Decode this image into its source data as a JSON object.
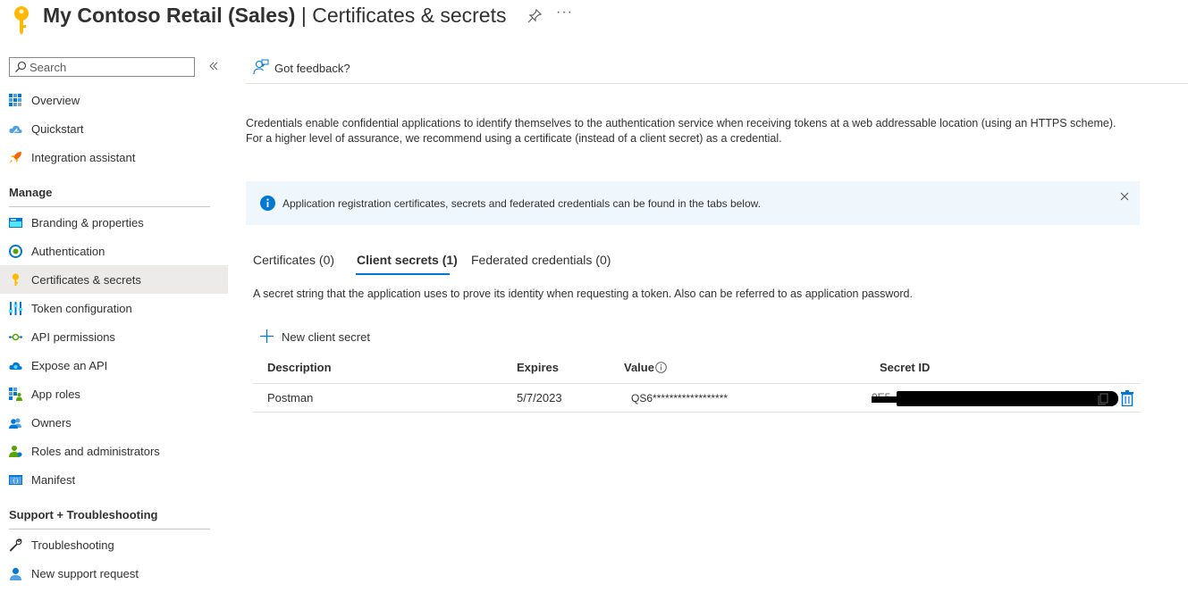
{
  "header": {
    "app_name": "My Contoso Retail (Sales)",
    "separator": " | ",
    "page_name": "Certificates & secrets",
    "more_label": "···",
    "accent": "#ffb900"
  },
  "sidebar": {
    "search_placeholder": "Search",
    "collapse_label": "«",
    "top_items": [
      {
        "label": "Overview",
        "icon": "grid-icon"
      },
      {
        "label": "Quickstart",
        "icon": "cloud-icon"
      },
      {
        "label": "Integration assistant",
        "icon": "rocket-icon"
      }
    ],
    "manage_heading": "Manage",
    "manage_items": [
      {
        "label": "Branding & properties",
        "icon": "branding-icon"
      },
      {
        "label": "Authentication",
        "icon": "authentication-icon"
      },
      {
        "label": "Certificates & secrets",
        "icon": "key-icon",
        "selected": true
      },
      {
        "label": "Token configuration",
        "icon": "token-config-icon"
      },
      {
        "label": "API permissions",
        "icon": "api-permissions-icon"
      },
      {
        "label": "Expose an API",
        "icon": "cloud-api-icon"
      },
      {
        "label": "App roles",
        "icon": "app-roles-icon"
      },
      {
        "label": "Owners",
        "icon": "owners-icon"
      },
      {
        "label": "Roles and administrators",
        "icon": "roles-admin-icon"
      },
      {
        "label": "Manifest",
        "icon": "manifest-icon"
      }
    ],
    "support_heading": "Support + Troubleshooting",
    "support_items": [
      {
        "label": "Troubleshooting",
        "icon": "wrench-icon"
      },
      {
        "label": "New support request",
        "icon": "support-person-icon"
      }
    ]
  },
  "toolbar": {
    "feedback_label": "Got feedback?"
  },
  "main": {
    "description": "Credentials enable confidential applications to identify themselves to the authentication service when receiving tokens at a web addressable location (using an HTTPS scheme). For a higher level of assurance, we recommend using a certificate (instead of a client secret) as a credential.",
    "info_banner": "Application registration certificates, secrets and federated credentials can be found in the tabs below.",
    "tabs": [
      {
        "label": "Certificates (0)",
        "active": false
      },
      {
        "label": "Client secrets (1)",
        "active": true
      },
      {
        "label": "Federated credentials (0)",
        "active": false
      }
    ],
    "secret_description": "A secret string that the application uses to prove its identity when requesting a token. Also can be referred to as application password.",
    "new_secret_label": "New client secret",
    "table": {
      "headers": [
        "Description",
        "Expires",
        "Value",
        "Secret ID"
      ],
      "rows": [
        {
          "description": "Postman",
          "expires": "5/7/2023",
          "value": "QS6******************",
          "secret_id": "0E5"
        }
      ]
    }
  }
}
